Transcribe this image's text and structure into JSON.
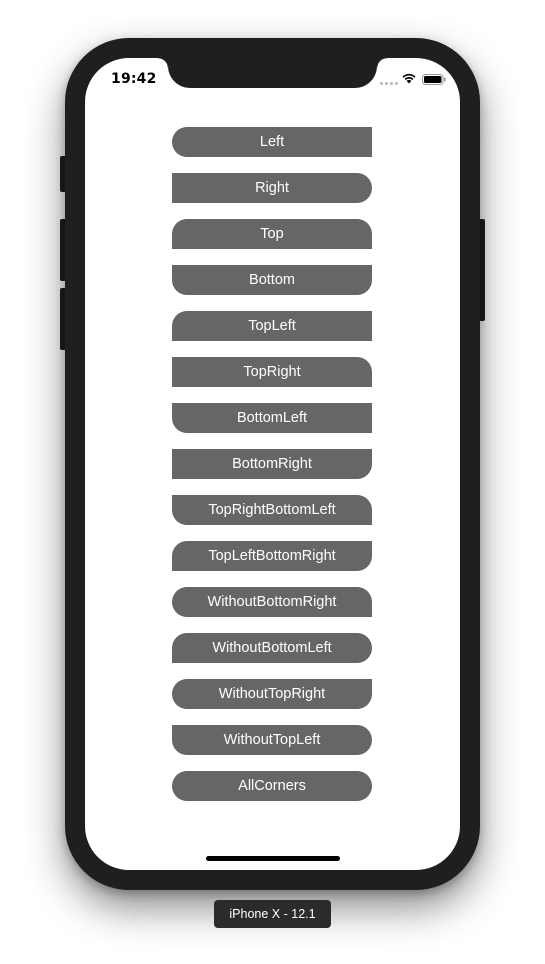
{
  "status_bar": {
    "time": "19:42",
    "icons": [
      "signal-dots-icon",
      "wifi-icon",
      "battery-icon"
    ]
  },
  "buttons": [
    {
      "label": "Left"
    },
    {
      "label": "Right"
    },
    {
      "label": "Top"
    },
    {
      "label": "Bottom"
    },
    {
      "label": "TopLeft"
    },
    {
      "label": "TopRight"
    },
    {
      "label": "BottomLeft"
    },
    {
      "label": "BottomRight"
    },
    {
      "label": "TopRightBottomLeft"
    },
    {
      "label": "TopLeftBottomRight"
    },
    {
      "label": "WithoutBottomRight"
    },
    {
      "label": "WithoutBottomLeft"
    },
    {
      "label": "WithoutTopRight"
    },
    {
      "label": "WithoutTopLeft"
    },
    {
      "label": "AllCorners"
    }
  ],
  "simulator": {
    "device_label": "iPhone X - 12.1"
  },
  "colors": {
    "button_bg": "#666666",
    "button_text": "#ffffff",
    "screen_bg": "#ffffff",
    "frame": "#1f1f1f"
  }
}
